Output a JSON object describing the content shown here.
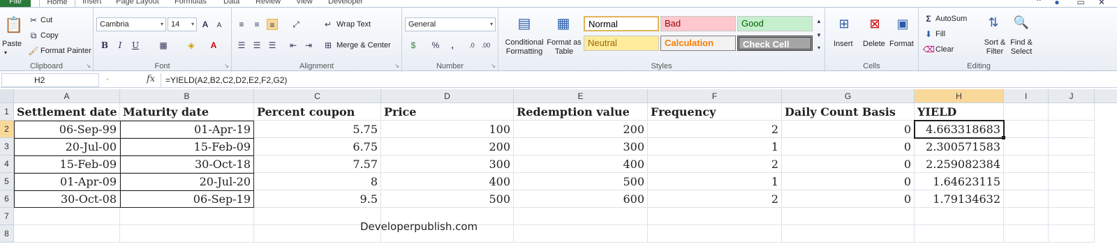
{
  "tabs": [
    "File",
    "Home",
    "Insert",
    "Page Layout",
    "Formulas",
    "Data",
    "Review",
    "View",
    "Developer"
  ],
  "clipboard": {
    "paste": "Paste",
    "cut": "Cut",
    "copy": "Copy",
    "format_painter": "Format Painter",
    "label": "Clipboard"
  },
  "font": {
    "name": "Cambria",
    "size": "14",
    "label": "Font",
    "bold": "B",
    "italic": "I",
    "underline": "U"
  },
  "alignment": {
    "wrap_text": "Wrap Text",
    "merge_center": "Merge & Center",
    "label": "Alignment"
  },
  "number": {
    "format": "General",
    "percent": "%",
    "comma": ",",
    "label": "Number"
  },
  "styles": {
    "conditional": "Conditional Formatting",
    "format_table": "Format as Table",
    "normal": "Normal",
    "bad": "Bad",
    "good": "Good",
    "neutral": "Neutral",
    "calculation": "Calculation",
    "check_cell": "Check Cell",
    "label": "Styles"
  },
  "cells": {
    "insert": "Insert",
    "delete": "Delete",
    "format": "Format",
    "label": "Cells"
  },
  "editing": {
    "autosum": "AutoSum",
    "fill": "Fill",
    "clear": "Clear",
    "sort_filter": "Sort & Filter",
    "find_select": "Find & Select",
    "label": "Editing"
  },
  "formula_bar": {
    "name_box": "H2",
    "fx": "fx",
    "formula": "=YIELD(A2,B2,C2,D2,E2,F2,G2)"
  },
  "sheet": {
    "columns": [
      "A",
      "B",
      "C",
      "D",
      "E",
      "F",
      "G",
      "H",
      "I",
      "J"
    ],
    "rows": [
      "1",
      "2",
      "3",
      "4",
      "5",
      "6",
      "7",
      "8"
    ],
    "headers": [
      "Settlement date",
      "Maturity date",
      "Percent coupon",
      "Price",
      "Redemption value",
      "Frequency",
      "Daily Count Basis",
      "YIELD"
    ],
    "data": [
      [
        "06-Sep-99",
        "01-Apr-19",
        "5.75",
        "100",
        "200",
        "2",
        "0",
        "4.663318683"
      ],
      [
        "20-Jul-00",
        "15-Feb-09",
        "6.75",
        "200",
        "300",
        "1",
        "0",
        "2.300571583"
      ],
      [
        "15-Feb-09",
        "30-Oct-18",
        "7.57",
        "300",
        "400",
        "2",
        "0",
        "2.259082384"
      ],
      [
        "01-Apr-09",
        "20-Jul-20",
        "8",
        "400",
        "500",
        "1",
        "0",
        "1.64623115"
      ],
      [
        "30-Oct-08",
        "06-Sep-19",
        "9.5",
        "500",
        "600",
        "2",
        "0",
        "1.79134632"
      ]
    ],
    "watermark": "Developerpublish.com"
  }
}
